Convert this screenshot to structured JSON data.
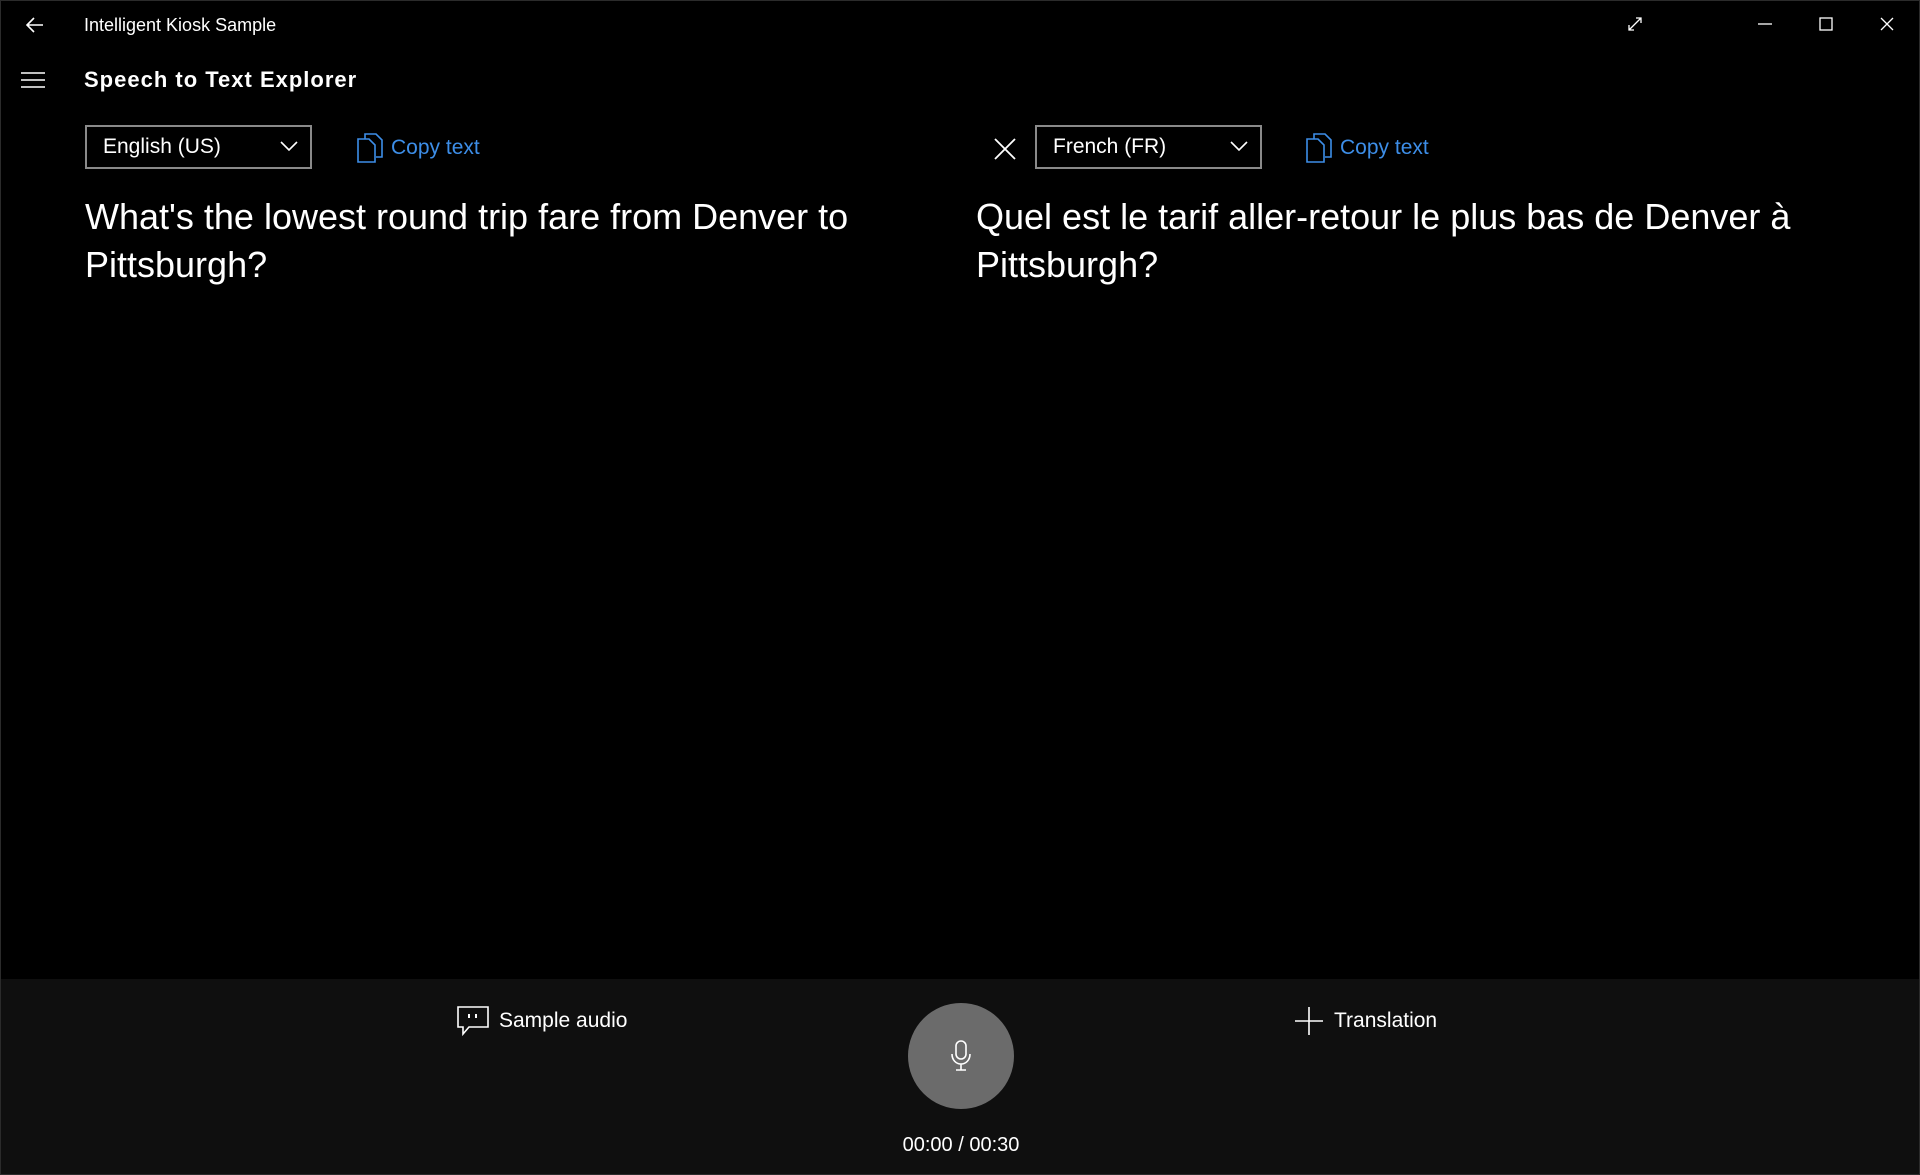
{
  "window": {
    "title": "Intelligent Kiosk Sample"
  },
  "header": {
    "page_title": "Speech to Text Explorer"
  },
  "source": {
    "language": "English (US)",
    "copy_label": "Copy text",
    "transcript": "What's the lowest round trip fare from Denver to Pittsburgh?"
  },
  "target": {
    "language": "French (FR)",
    "copy_label": "Copy text",
    "transcript": "Quel est le tarif aller-retour le plus bas de Denver à Pittsburgh?"
  },
  "bottom": {
    "sample_audio_label": "Sample audio",
    "translation_label": "Translation",
    "timer": "00:00 / 00:30"
  },
  "icons": {
    "back": "back-arrow-icon",
    "expand": "expand-icon",
    "minimize": "minimize-icon",
    "maximize": "maximize-icon",
    "close": "close-icon",
    "menu": "hamburger-icon",
    "copy": "copy-icon",
    "remove": "close-icon",
    "sample_audio": "speech-bubble-icon",
    "add": "plus-icon",
    "mic": "microphone-icon"
  },
  "colors": {
    "background": "#000000",
    "bottom_bar": "#0f0f0f",
    "accent": "#3d8ee8",
    "mic_button": "#6b6b6b",
    "dropdown_border": "#8a8a8a"
  }
}
